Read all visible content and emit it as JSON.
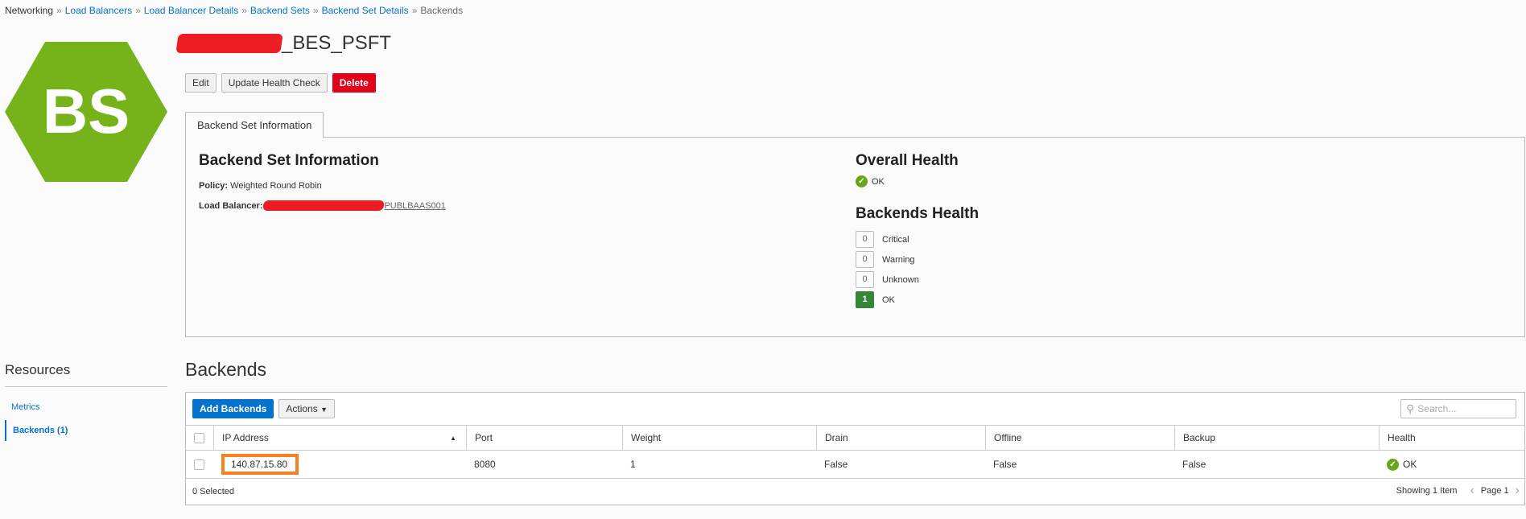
{
  "breadcrumb": {
    "items": [
      "Networking",
      "Load Balancers",
      "Load Balancer Details",
      "Backend Sets",
      "Backend Set Details",
      "Backends"
    ],
    "separator": "»"
  },
  "logo": {
    "text": "BS",
    "color": "#76b31b"
  },
  "header": {
    "title_suffix": "_BES_PSFT"
  },
  "toolbar": {
    "edit": "Edit",
    "update_health": "Update Health Check",
    "delete": "Delete"
  },
  "tabs": [
    {
      "label": "Backend Set Information"
    }
  ],
  "info": {
    "heading": "Backend Set Information",
    "policy_label": "Policy:",
    "policy_value": "Weighted Round Robin",
    "lb_label": "Load Balancer:",
    "lb_value_suffix": "PUBLBAAS001"
  },
  "overall_health": {
    "heading": "Overall Health",
    "status": "OK"
  },
  "backends_health": {
    "heading": "Backends Health",
    "items": [
      {
        "count": "0",
        "label": "Critical"
      },
      {
        "count": "0",
        "label": "Warning"
      },
      {
        "count": "0",
        "label": "Unknown"
      },
      {
        "count": "1",
        "label": "OK"
      }
    ]
  },
  "resources": {
    "heading": "Resources",
    "items": [
      "Metrics",
      "Backends (1)"
    ]
  },
  "backends": {
    "heading": "Backends",
    "add": "Add Backends",
    "actions": "Actions",
    "search_placeholder": "Search...",
    "columns": [
      "IP Address",
      "Port",
      "Weight",
      "Drain",
      "Offline",
      "Backup",
      "Health"
    ],
    "rows": [
      [
        "140.87.15.80",
        "8080",
        "1",
        "False",
        "False",
        "False",
        "OK"
      ]
    ],
    "selected": "0 Selected",
    "showing": "Showing 1 Item",
    "page": "Page 1"
  }
}
